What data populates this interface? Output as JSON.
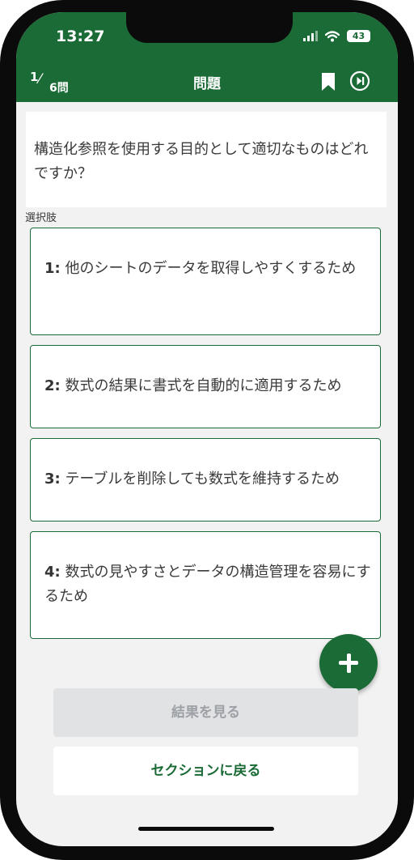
{
  "status_bar": {
    "time": "13:27",
    "battery": "43"
  },
  "header": {
    "progress_current": "1",
    "progress_total": "6問",
    "title": "問題",
    "icons": [
      "bookmark-icon",
      "skip-next-icon"
    ]
  },
  "question": {
    "text": "構造化参照を使用する目的として適切なものはどれですか？"
  },
  "choices_label": "選択肢",
  "choices": [
    {
      "number": "1:",
      "text": "他のシートのデータを取得しやすくするため"
    },
    {
      "number": "2:",
      "text": "数式の結果に書式を自動的に適用するため"
    },
    {
      "number": "3:",
      "text": "テーブルを削除しても数式を維持するため"
    },
    {
      "number": "4:",
      "text": "数式の見やすさとデータの構造管理を容易にするため"
    }
  ],
  "buttons": {
    "view_results": "結果を見る",
    "back_to_section": "セクションに戻る"
  },
  "colors": {
    "accent": "#1b6b36",
    "background": "#f2f2f2",
    "disabled_button": "#e0e2e4"
  }
}
